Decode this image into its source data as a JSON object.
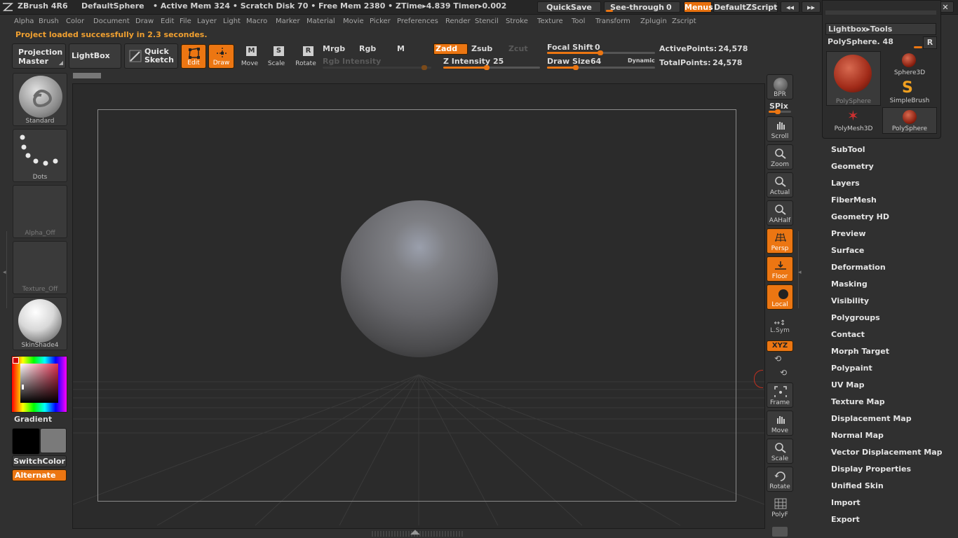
{
  "titlebar": {
    "app": "ZBrush 4R6",
    "doc": "DefaultSphere",
    "stats": "• Active Mem 324 • Scratch Disk 70 • Free Mem 2380 • ZTime▸4.839 Timer▸0.002",
    "quicksave": "QuickSave",
    "see_through": "See-through",
    "see_through_value": "0",
    "see_through_fraction": 0,
    "menus": "Menus",
    "script": "DefaultZScript"
  },
  "menubar": [
    "Alpha",
    "Brush",
    "Color",
    "Document",
    "Draw",
    "Edit",
    "File",
    "Layer",
    "Light",
    "Macro",
    "Marker",
    "Material",
    "Movie",
    "Picker",
    "Preferences",
    "Render",
    "Stencil",
    "Stroke",
    "Texture",
    "Tool",
    "Transform",
    "Zplugin",
    "Zscript"
  ],
  "status_message": "Project loaded successfully in 2.3 secondes.",
  "toolbar": {
    "projection_master": [
      "Projection",
      "Master"
    ],
    "lightbox": "LightBox",
    "quick_sketch": [
      "Quick",
      "Sketch"
    ],
    "edit": "Edit",
    "draw": "Draw",
    "move": "Move",
    "scale": "Scale",
    "rotate": "Rotate",
    "mrgb": "Mrgb",
    "rgb": "Rgb",
    "m": "M",
    "zadd": "Zadd",
    "zsub": "Zsub",
    "zcut": "Zcut",
    "rgb_intensity": "Rgb Intensity",
    "z_intensity_label": "Z Intensity",
    "z_intensity": "25",
    "focal_shift_label": "Focal Shift",
    "focal_shift": "0",
    "draw_size_label": "Draw Size",
    "draw_size": "64",
    "dynamic": "Dynamic",
    "active_points_label": "ActivePoints:",
    "active_points": "24,578",
    "total_points_label": "TotalPoints:",
    "total_points": "24,578"
  },
  "left_shelf": {
    "brush": "Standard",
    "stroke": "Dots",
    "alpha": "Alpha_Off",
    "texture": "Texture_Off",
    "material": "SkinShade4",
    "gradient": "Gradient",
    "switch_color": "SwitchColor",
    "alternate": "Alternate"
  },
  "right_shelf": {
    "bpr": "BPR",
    "spix": "SPix",
    "scroll": "Scroll",
    "zoom": "Zoom",
    "actual": "Actual",
    "aahalf": "AAHalf",
    "persp": "Persp",
    "floor": "Floor",
    "local": "Local",
    "lsym": "L.Sym",
    "xyz": "XYZ",
    "frame": "Frame",
    "move": "Move",
    "scale": "Scale",
    "rotate": "Rotate",
    "polyf": "PolyF"
  },
  "tool_panel": {
    "lightbox_tools": "Lightbox▸Tools",
    "current_tool": "PolySphere. 48",
    "r": "R",
    "items": [
      "PolySphere",
      "Sphere3D",
      "SimpleBrush",
      "PolyMesh3D",
      "PolySphere"
    ]
  },
  "tool_menu": [
    "SubTool",
    "Geometry",
    "Layers",
    "FiberMesh",
    "Geometry HD",
    "Preview",
    "Surface",
    "Deformation",
    "Masking",
    "Visibility",
    "Polygroups",
    "Contact",
    "Morph Target",
    "Polypaint",
    "UV Map",
    "Texture Map",
    "Displacement Map",
    "Normal Map",
    "Vector Displacement Map",
    "Display Properties",
    "Unified Skin",
    "Import",
    "Export"
  ],
  "colors": {
    "accent": "#ec7612",
    "background": "#303030",
    "status": "#f0a030"
  }
}
